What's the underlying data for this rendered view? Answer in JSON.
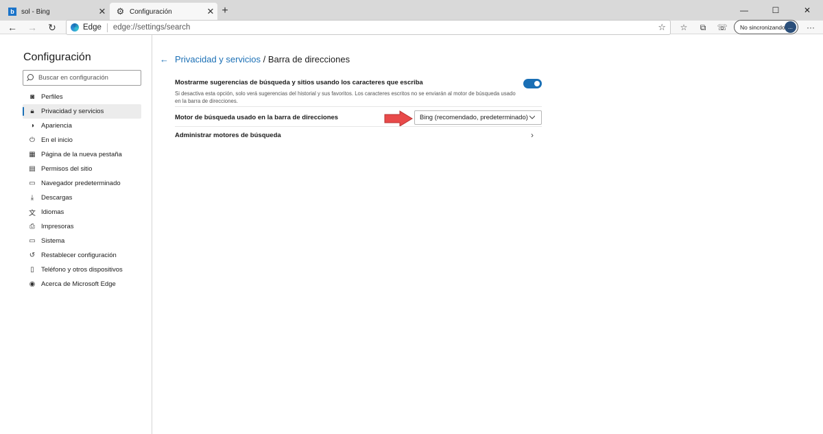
{
  "tabs": [
    {
      "title": "sol - Bing",
      "favicon": "bing-icon",
      "active": false
    },
    {
      "title": "Configuración",
      "favicon": "gear-icon",
      "active": true
    }
  ],
  "window_controls": {
    "minimize": "—",
    "maximize": "☐",
    "close": "✕"
  },
  "address_bar": {
    "site_label": "Edge",
    "url": "edge://settings/search"
  },
  "account": {
    "label": "No sincronizando",
    "avatar": "..."
  },
  "sidebar": {
    "title": "Configuración",
    "search_placeholder": "Buscar en configuración",
    "items": [
      {
        "label": "Perfiles",
        "icon": "profile-icon",
        "glyph": "◙"
      },
      {
        "label": "Privacidad y servicios",
        "icon": "lock-icon",
        "glyph": "🔒︎",
        "active": true
      },
      {
        "label": "Apariencia",
        "icon": "palette-icon",
        "glyph": "◑"
      },
      {
        "label": "En el inicio",
        "icon": "power-icon",
        "glyph": "⏻"
      },
      {
        "label": "Página de la nueva pestaña",
        "icon": "grid-icon",
        "glyph": "▦"
      },
      {
        "label": "Permisos del sitio",
        "icon": "site-permissions-icon",
        "glyph": "▤"
      },
      {
        "label": "Navegador predeterminado",
        "icon": "browser-icon",
        "glyph": "▭"
      },
      {
        "label": "Descargas",
        "icon": "download-icon",
        "glyph": "⤓"
      },
      {
        "label": "Idiomas",
        "icon": "language-icon",
        "glyph": "文"
      },
      {
        "label": "Impresoras",
        "icon": "printer-icon",
        "glyph": "⎙"
      },
      {
        "label": "Sistema",
        "icon": "laptop-icon",
        "glyph": "▭"
      },
      {
        "label": "Restablecer configuración",
        "icon": "reset-icon",
        "glyph": "↺"
      },
      {
        "label": "Teléfono y otros dispositivos",
        "icon": "phone-icon",
        "glyph": "▯"
      },
      {
        "label": "Acerca de Microsoft Edge",
        "icon": "edge-icon",
        "glyph": "◉"
      }
    ]
  },
  "main": {
    "breadcrumb_parent": "Privacidad y servicios",
    "breadcrumb_sep": " / ",
    "breadcrumb_current": "Barra de direcciones",
    "suggestions": {
      "title": "Mostrarme sugerencias de búsqueda y sitios usando los caracteres que escriba",
      "description": "Si desactiva esta opción, solo verá sugerencias del historial y sus favoritos. Los caracteres escritos no se enviarán al motor de búsqueda usado en la barra de direcciones.",
      "enabled": true
    },
    "engine": {
      "label": "Motor de búsqueda usado en la barra de direcciones",
      "selected": "Bing (recomendado, predeterminado)"
    },
    "manage": {
      "label": "Administrar motores de búsqueda"
    }
  },
  "colors": {
    "accent": "#1a6fb5",
    "arrow": "#e84a4a"
  }
}
